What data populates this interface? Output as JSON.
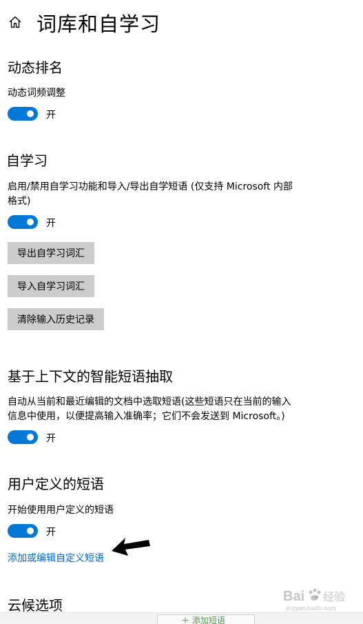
{
  "header": {
    "title": "词库和自学习"
  },
  "dynamic_ranking": {
    "title": "动态排名",
    "setting_label": "动态词频调整",
    "toggle_state": "开"
  },
  "self_learning": {
    "title": "自学习",
    "setting_label_line1": "启用/禁用自学习功能和导入/导出自学短语 (仅支持 Microsoft 内部",
    "setting_label_line2": "格式)",
    "toggle_state": "开",
    "export_button": "导出自学习词汇",
    "import_button": "导入自学习词汇",
    "clear_button": "清除输入历史记录"
  },
  "context_extraction": {
    "title": "基于上下文的智能短语抽取",
    "description_line1": "自动从当前和最近编辑的文档中选取短语(这些短语只在当前的输入",
    "description_line2": "信息中使用，以便提高输入准确率；它们不会发送到 Microsoft。)",
    "toggle_state": "开"
  },
  "user_phrases": {
    "title": "用户定义的短语",
    "setting_label": "开始使用用户定义的短语",
    "toggle_state": "开",
    "edit_link": "添加或编辑自定义短语"
  },
  "cloud": {
    "title": "云候选项"
  },
  "watermark": {
    "text": "Bai 经验",
    "subtext": "jingyan.baidu.com"
  },
  "colors": {
    "accent": "#0078d7",
    "link": "#0066cc",
    "button_bg": "#cccccc"
  }
}
